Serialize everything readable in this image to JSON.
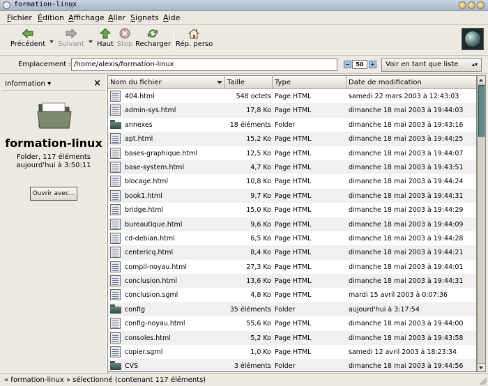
{
  "window": {
    "title": "formation-linux"
  },
  "menu": [
    {
      "label": "Fichier",
      "u": "F",
      "rest": "ichier"
    },
    {
      "label": "Édition",
      "u": "É",
      "rest": "dition"
    },
    {
      "label": "Affichage",
      "u": "A",
      "rest": "ffichage"
    },
    {
      "label": "Aller",
      "u": "A",
      "rest": "ller"
    },
    {
      "label": "Signets",
      "u": "S",
      "rest": "ignets"
    },
    {
      "label": "Aide",
      "u": "A",
      "rest": "ide"
    }
  ],
  "toolbar": {
    "back": "Précédent",
    "forward": "Suivant",
    "up": "Haut",
    "stop": "Stop",
    "reload": "Recharger",
    "home": "Rép. perso"
  },
  "location": {
    "label": "Emplacement :",
    "path": "/home/alexis/formation-linux",
    "zoom": "50",
    "view_mode": "Voir en tant que liste"
  },
  "sidepane": {
    "title": "Information",
    "folder_name": "formation-linux",
    "folder_info": "Folder, 117 éléments",
    "folder_date": "aujourd'hui à 3:50:11",
    "open_with": "Ouvrir avec..."
  },
  "columns": {
    "name": "Nom du fichier",
    "size": "Taille",
    "type": "Type",
    "date": "Date de modification"
  },
  "files": [
    {
      "name": "404.html",
      "size": "548 octets",
      "type": "Page HTML",
      "date": "samedi 22 mars 2003 à 12:43:03",
      "kind": "file"
    },
    {
      "name": "admin-sys.html",
      "size": "17,8 Ko",
      "type": "Page HTML",
      "date": "dimanche 18 mai 2003 à 19:44:03",
      "kind": "file"
    },
    {
      "name": "annexes",
      "size": "18 éléments",
      "type": "Folder",
      "date": "dimanche 18 mai 2003 à 19:43:16",
      "kind": "folder"
    },
    {
      "name": "apt.html",
      "size": "15,2 Ko",
      "type": "Page HTML",
      "date": "dimanche 18 mai 2003 à 19:44:25",
      "kind": "file"
    },
    {
      "name": "bases-graphique.html",
      "size": "12,5 Ko",
      "type": "Page HTML",
      "date": "dimanche 18 mai 2003 à 19:44:07",
      "kind": "file"
    },
    {
      "name": "base-system.html",
      "size": "4,7 Ko",
      "type": "Page HTML",
      "date": "dimanche 18 mai 2003 à 19:43:51",
      "kind": "file"
    },
    {
      "name": "blocage.html",
      "size": "10,8 Ko",
      "type": "Page HTML",
      "date": "dimanche 18 mai 2003 à 19:44:24",
      "kind": "file"
    },
    {
      "name": "book1.html",
      "size": "9,7 Ko",
      "type": "Page HTML",
      "date": "dimanche 18 mai 2003 à 19:44:31",
      "kind": "file"
    },
    {
      "name": "bridge.html",
      "size": "15,0 Ko",
      "type": "Page HTML",
      "date": "dimanche 18 mai 2003 à 19:44:29",
      "kind": "file"
    },
    {
      "name": "bureautique.html",
      "size": "9,6 Ko",
      "type": "Page HTML",
      "date": "dimanche 18 mai 2003 à 19:44:09",
      "kind": "file"
    },
    {
      "name": "cd-debian.html",
      "size": "6,5 Ko",
      "type": "Page HTML",
      "date": "dimanche 18 mai 2003 à 19:44:28",
      "kind": "file"
    },
    {
      "name": "centericq.html",
      "size": "8,4 Ko",
      "type": "Page HTML",
      "date": "dimanche 18 mai 2003 à 19:44:21",
      "kind": "file"
    },
    {
      "name": "compil-noyau.html",
      "size": "27,3 Ko",
      "type": "Page HTML",
      "date": "dimanche 18 mai 2003 à 19:44:01",
      "kind": "file"
    },
    {
      "name": "conclusion.html",
      "size": "13,6 Ko",
      "type": "Page HTML",
      "date": "dimanche 18 mai 2003 à 19:44:31",
      "kind": "file"
    },
    {
      "name": "conclusion.sgml",
      "size": "4,8 Ko",
      "type": "Page HTML",
      "date": "mardi 15 avril 2003 à 0:07:36",
      "kind": "file"
    },
    {
      "name": "config",
      "size": "35 éléments",
      "type": "Folder",
      "date": "aujourd'hui à 3:17:54",
      "kind": "folder"
    },
    {
      "name": "config-noyau.html",
      "size": "55,6 Ko",
      "type": "Page HTML",
      "date": "dimanche 18 mai 2003 à 19:44:00",
      "kind": "file"
    },
    {
      "name": "consoles.html",
      "size": "5,2 Ko",
      "type": "Page HTML",
      "date": "dimanche 18 mai 2003 à 19:43:58",
      "kind": "file"
    },
    {
      "name": "copier.sgml",
      "size": "1,0 Ko",
      "type": "Page HTML",
      "date": "samedi 12 avril 2003 à 18:23:34",
      "kind": "file"
    },
    {
      "name": "CVS",
      "size": "3 éléments",
      "type": "Folder",
      "date": "dimanche 18 mai 2003 à 19:44:56",
      "kind": "folder"
    }
  ],
  "status": "« formation-linux » sélectionné (contenant 117 éléments)"
}
